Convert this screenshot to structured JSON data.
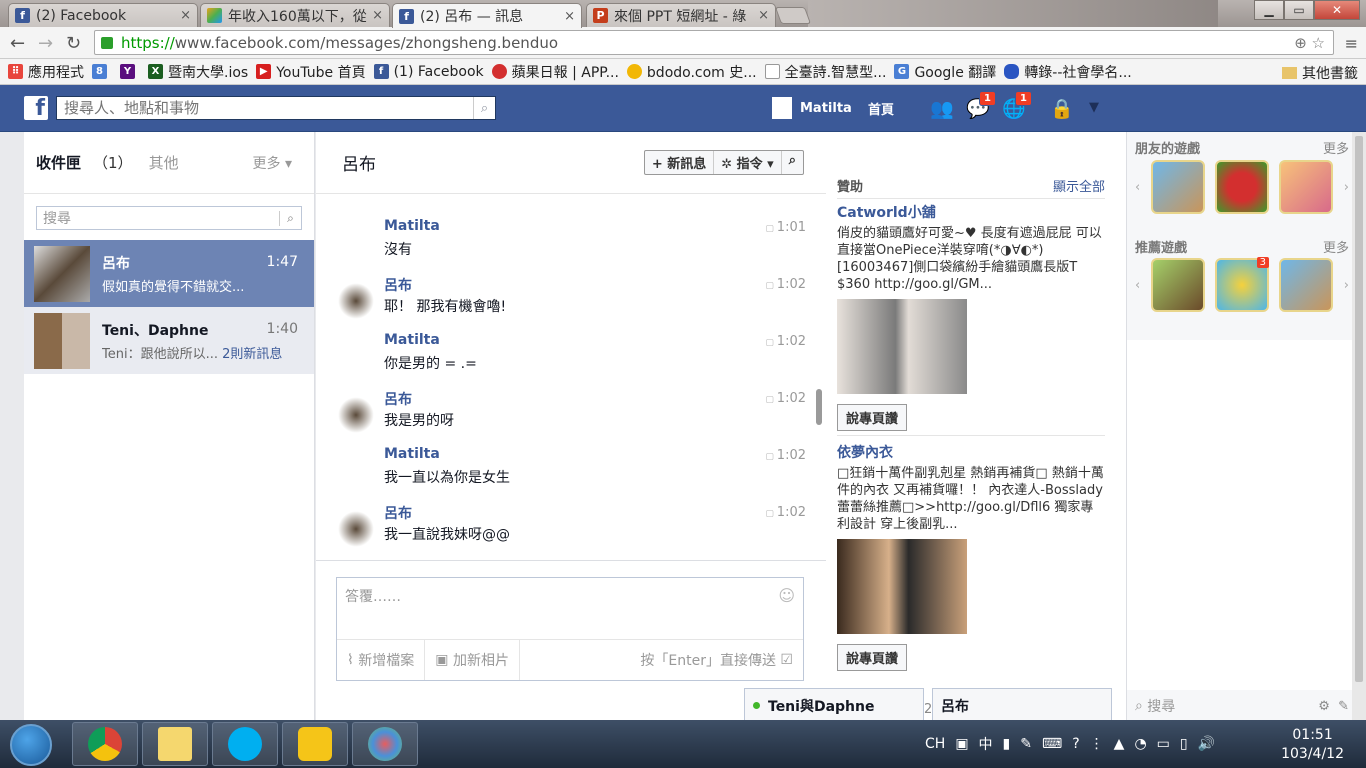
{
  "browser": {
    "tabs": [
      {
        "title": "(2) Facebook",
        "icon": "facebook-icon",
        "color": "#3b5998"
      },
      {
        "title": "年收入160萬以下，從",
        "icon": "colorful-app-icon",
        "color": "#e8a21b"
      },
      {
        "title": "(2) 呂布 — 訊息",
        "icon": "facebook-icon",
        "color": "#3b5998"
      },
      {
        "title": "來個 PPT 短網址 - 綠",
        "icon": "ppt-icon",
        "color": "#c43e1c"
      }
    ],
    "close_glyph": "×",
    "url_scheme": "https://",
    "url_rest": "www.facebook.com/messages/zhongsheng.benduo",
    "bookmarks": [
      {
        "label": "應用程式",
        "icon": "apps-icon",
        "color": "#e8453c"
      },
      {
        "label": "",
        "icon": "number-8-icon",
        "color": "#4a7fd4"
      },
      {
        "label": "",
        "icon": "yahoo-icon",
        "color": "#5a0e7e"
      },
      {
        "label": "暨南大學.ios",
        "icon": "ncnu-icon",
        "color": "#1b5e20"
      },
      {
        "label": "YouTube 首頁",
        "icon": "youtube-icon",
        "color": "#d71f1f"
      },
      {
        "label": "(1) Facebook",
        "icon": "facebook-icon",
        "color": "#3b5998"
      },
      {
        "label": "蘋果日報 | APP...",
        "icon": "apple-daily-icon",
        "color": "#d32f2f"
      },
      {
        "label": "bdodo.com 史...",
        "icon": "sun-icon",
        "color": "#f2b705"
      },
      {
        "label": "全臺詩.智慧型...",
        "icon": "page-icon",
        "color": "#9e9e9e"
      },
      {
        "label": "Google 翻譯",
        "icon": "google-translate-icon",
        "color": "#4a7fd4"
      },
      {
        "label": "轉錄--社會學名...",
        "icon": "chat-bubble-icon",
        "color": "#2a55c2"
      }
    ],
    "other_bookmarks": "其他書籤"
  },
  "fb": {
    "logo": "f",
    "search_placeholder": "搜尋人、地點和事物",
    "user_name": "Matilta",
    "home": "首頁",
    "messages_badge": "1",
    "notifications_badge": "1"
  },
  "inbox": {
    "label": "收件匣",
    "count": "（1）",
    "other": "其他",
    "more": "更多 ▾",
    "search_placeholder": "搜尋",
    "threads": [
      {
        "name": "呂布",
        "snippet": "假如真的覺得不錯就交...",
        "time": "1:47",
        "extra": ""
      },
      {
        "name": "Teni、Daphne",
        "snippet": "Teni：跟他說所以...",
        "time": "1:40",
        "extra": "2則新訊息"
      }
    ]
  },
  "conversation": {
    "title": "呂布",
    "new_message": "+ 新訊息",
    "actions": "✲ 指令 ▾",
    "search_glyph": "⌕",
    "messages": [
      {
        "sender": "Matilta",
        "text": "沒有",
        "time": "1:01",
        "avatar": false
      },
      {
        "sender": "呂布",
        "text": "耶！ 那我有機會嚕!",
        "time": "1:02",
        "avatar": true
      },
      {
        "sender": "Matilta",
        "text": "你是男的 = .=",
        "time": "1:02",
        "avatar": false
      },
      {
        "sender": "呂布",
        "text": "我是男的呀",
        "time": "1:02",
        "avatar": true
      },
      {
        "sender": "Matilta",
        "text": "我一直以為你是女生",
        "time": "1:02",
        "avatar": false
      },
      {
        "sender": "呂布",
        "text": "我一直說我妹呀@@",
        "time": "1:02",
        "avatar": true
      }
    ],
    "reply_placeholder": "答覆……",
    "attach_file": "新增檔案",
    "add_photo": "加新相片",
    "enter_to_send": "按「Enter」直接傳送"
  },
  "ads": {
    "header": "贊助",
    "see_all": "顯示全部",
    "items": [
      {
        "title": "Catworld小舖",
        "desc": "俏皮的貓頭鷹好可愛~♥ 長度有遮過屁屁 可以直接當OnePiece洋裝穿唷(*◑∀◐*) [16003467]側口袋繽紛手繪貓頭鷹長版T $360 http://goo.gl/GM...",
        "button": "說專頁讚"
      },
      {
        "title": "依夢內衣",
        "desc": "□狂銷十萬件副乳剋星 熱銷再補貨□ 熱銷十萬件的內衣 又再補貨囉！！ 內衣達人-Bosslady蕾蕾絲推薦□>>http://goo.gl/Dfll6 獨家專利設計 穿上後副乳...",
        "button": "說專頁讚"
      }
    ]
  },
  "sidebar": {
    "friends_games": "朋友的遊戲",
    "recommended_games": "推薦遊戲",
    "more": "更多",
    "game_badge": "3",
    "search_placeholder": "搜尋"
  },
  "chat_tabs": [
    {
      "name": "Teni與Daphne",
      "online": true
    },
    {
      "name": "呂布",
      "online": false
    }
  ],
  "chat_count": "2",
  "taskbar": {
    "lang": "CH",
    "ime": "中",
    "time": "01:51",
    "date": "103/4/12"
  }
}
